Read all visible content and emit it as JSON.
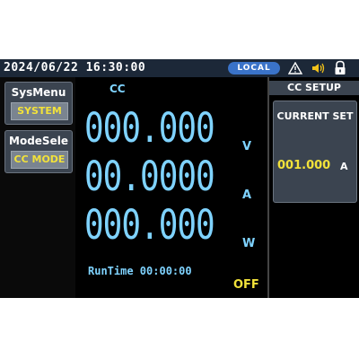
{
  "status_bar": {
    "datetime": "2024/06/22 16:30:00",
    "control_mode": "LOCAL",
    "icons": [
      "warning-icon",
      "speaker-icon",
      "lock-icon"
    ]
  },
  "left_menu": {
    "sys_menu": {
      "title": "SysMenu",
      "value": "SYSTEM"
    },
    "mode_select": {
      "title": "ModeSele",
      "value": "CC MODE"
    }
  },
  "readout": {
    "mode": "CC",
    "voltage": {
      "value": "000.000",
      "unit": "V"
    },
    "current": {
      "value": "00.0000",
      "unit": "A"
    },
    "power": {
      "value": "000.000",
      "unit": "W"
    },
    "runtime": "RunTime 00:00:00",
    "output_state": "OFF"
  },
  "setup": {
    "header": "CC SETUP",
    "title": "CURRENT SET",
    "value": "001.000",
    "unit": "A"
  },
  "colors": {
    "readout": "#7fd3ff",
    "highlight": "#f2e23a",
    "badge": "#3a73c9",
    "panel": "#3b4450"
  }
}
